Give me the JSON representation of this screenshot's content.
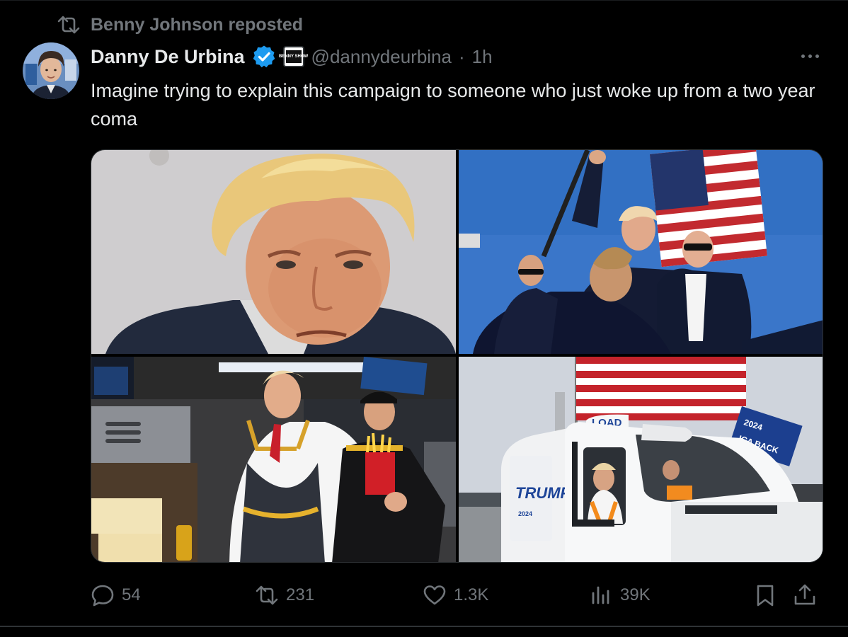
{
  "repost": {
    "label": "Benny Johnson reposted"
  },
  "author": {
    "name": "Danny De Urbina",
    "handle": "@dannydeurbina",
    "separator": "·",
    "time": "1h"
  },
  "affiliate_badge": {
    "text": "BENNY SHOW"
  },
  "tweet": {
    "text": "Imagine trying to explain this campaign to someone who just woke up from a two year coma"
  },
  "media": {
    "banner_text": "LOAD",
    "truck_text": "TRUMP",
    "truck_year": "2024",
    "flag_text_1": "2024",
    "flag_text_2": "ICA BACK"
  },
  "actions": {
    "replies": "54",
    "reposts": "231",
    "likes": "1.3K",
    "views": "39K"
  },
  "colors": {
    "background": "#000000",
    "text": "#e7e9ea",
    "muted": "#71767b",
    "verified": "#1d9bf0"
  }
}
